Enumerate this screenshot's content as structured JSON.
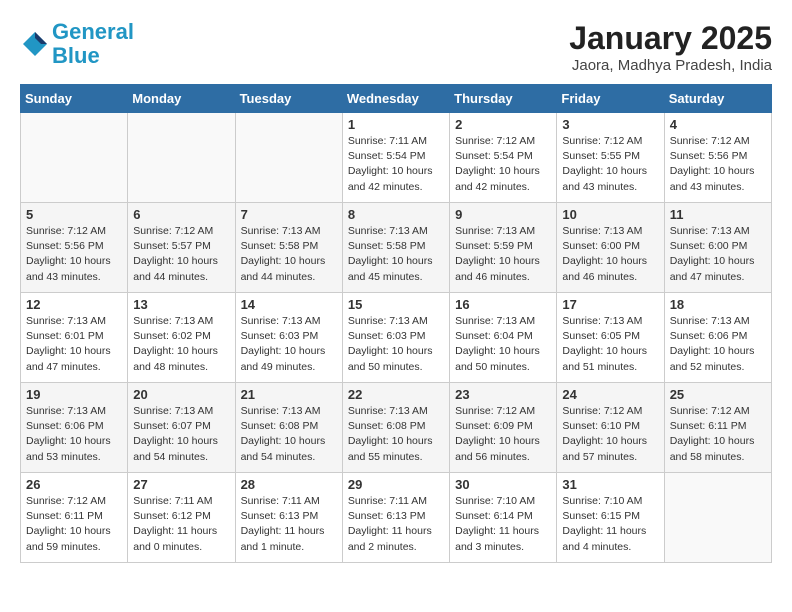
{
  "header": {
    "logo_line1": "General",
    "logo_line2": "Blue",
    "month_title": "January 2025",
    "location": "Jaora, Madhya Pradesh, India"
  },
  "days_of_week": [
    "Sunday",
    "Monday",
    "Tuesday",
    "Wednesday",
    "Thursday",
    "Friday",
    "Saturday"
  ],
  "weeks": [
    [
      {
        "day": "",
        "info": ""
      },
      {
        "day": "",
        "info": ""
      },
      {
        "day": "",
        "info": ""
      },
      {
        "day": "1",
        "info": "Sunrise: 7:11 AM\nSunset: 5:54 PM\nDaylight: 10 hours\nand 42 minutes."
      },
      {
        "day": "2",
        "info": "Sunrise: 7:12 AM\nSunset: 5:54 PM\nDaylight: 10 hours\nand 42 minutes."
      },
      {
        "day": "3",
        "info": "Sunrise: 7:12 AM\nSunset: 5:55 PM\nDaylight: 10 hours\nand 43 minutes."
      },
      {
        "day": "4",
        "info": "Sunrise: 7:12 AM\nSunset: 5:56 PM\nDaylight: 10 hours\nand 43 minutes."
      }
    ],
    [
      {
        "day": "5",
        "info": "Sunrise: 7:12 AM\nSunset: 5:56 PM\nDaylight: 10 hours\nand 43 minutes."
      },
      {
        "day": "6",
        "info": "Sunrise: 7:12 AM\nSunset: 5:57 PM\nDaylight: 10 hours\nand 44 minutes."
      },
      {
        "day": "7",
        "info": "Sunrise: 7:13 AM\nSunset: 5:58 PM\nDaylight: 10 hours\nand 44 minutes."
      },
      {
        "day": "8",
        "info": "Sunrise: 7:13 AM\nSunset: 5:58 PM\nDaylight: 10 hours\nand 45 minutes."
      },
      {
        "day": "9",
        "info": "Sunrise: 7:13 AM\nSunset: 5:59 PM\nDaylight: 10 hours\nand 46 minutes."
      },
      {
        "day": "10",
        "info": "Sunrise: 7:13 AM\nSunset: 6:00 PM\nDaylight: 10 hours\nand 46 minutes."
      },
      {
        "day": "11",
        "info": "Sunrise: 7:13 AM\nSunset: 6:00 PM\nDaylight: 10 hours\nand 47 minutes."
      }
    ],
    [
      {
        "day": "12",
        "info": "Sunrise: 7:13 AM\nSunset: 6:01 PM\nDaylight: 10 hours\nand 47 minutes."
      },
      {
        "day": "13",
        "info": "Sunrise: 7:13 AM\nSunset: 6:02 PM\nDaylight: 10 hours\nand 48 minutes."
      },
      {
        "day": "14",
        "info": "Sunrise: 7:13 AM\nSunset: 6:03 PM\nDaylight: 10 hours\nand 49 minutes."
      },
      {
        "day": "15",
        "info": "Sunrise: 7:13 AM\nSunset: 6:03 PM\nDaylight: 10 hours\nand 50 minutes."
      },
      {
        "day": "16",
        "info": "Sunrise: 7:13 AM\nSunset: 6:04 PM\nDaylight: 10 hours\nand 50 minutes."
      },
      {
        "day": "17",
        "info": "Sunrise: 7:13 AM\nSunset: 6:05 PM\nDaylight: 10 hours\nand 51 minutes."
      },
      {
        "day": "18",
        "info": "Sunrise: 7:13 AM\nSunset: 6:06 PM\nDaylight: 10 hours\nand 52 minutes."
      }
    ],
    [
      {
        "day": "19",
        "info": "Sunrise: 7:13 AM\nSunset: 6:06 PM\nDaylight: 10 hours\nand 53 minutes."
      },
      {
        "day": "20",
        "info": "Sunrise: 7:13 AM\nSunset: 6:07 PM\nDaylight: 10 hours\nand 54 minutes."
      },
      {
        "day": "21",
        "info": "Sunrise: 7:13 AM\nSunset: 6:08 PM\nDaylight: 10 hours\nand 54 minutes."
      },
      {
        "day": "22",
        "info": "Sunrise: 7:13 AM\nSunset: 6:08 PM\nDaylight: 10 hours\nand 55 minutes."
      },
      {
        "day": "23",
        "info": "Sunrise: 7:12 AM\nSunset: 6:09 PM\nDaylight: 10 hours\nand 56 minutes."
      },
      {
        "day": "24",
        "info": "Sunrise: 7:12 AM\nSunset: 6:10 PM\nDaylight: 10 hours\nand 57 minutes."
      },
      {
        "day": "25",
        "info": "Sunrise: 7:12 AM\nSunset: 6:11 PM\nDaylight: 10 hours\nand 58 minutes."
      }
    ],
    [
      {
        "day": "26",
        "info": "Sunrise: 7:12 AM\nSunset: 6:11 PM\nDaylight: 10 hours\nand 59 minutes."
      },
      {
        "day": "27",
        "info": "Sunrise: 7:11 AM\nSunset: 6:12 PM\nDaylight: 11 hours\nand 0 minutes."
      },
      {
        "day": "28",
        "info": "Sunrise: 7:11 AM\nSunset: 6:13 PM\nDaylight: 11 hours\nand 1 minute."
      },
      {
        "day": "29",
        "info": "Sunrise: 7:11 AM\nSunset: 6:13 PM\nDaylight: 11 hours\nand 2 minutes."
      },
      {
        "day": "30",
        "info": "Sunrise: 7:10 AM\nSunset: 6:14 PM\nDaylight: 11 hours\nand 3 minutes."
      },
      {
        "day": "31",
        "info": "Sunrise: 7:10 AM\nSunset: 6:15 PM\nDaylight: 11 hours\nand 4 minutes."
      },
      {
        "day": "",
        "info": ""
      }
    ]
  ]
}
